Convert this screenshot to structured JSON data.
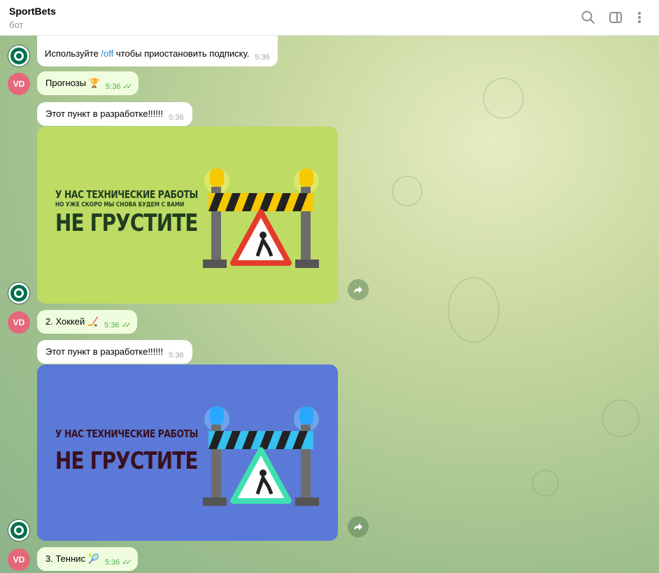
{
  "header": {
    "title": "SportBets",
    "subtitle": "бот"
  },
  "messages": {
    "m1": {
      "text_before": "Используйте ",
      "link": "/off",
      "text_after": " чтобы приостановить подписку.",
      "time": "5:36"
    },
    "m2": {
      "text": "Прогнозы 🏆",
      "time": "5:36"
    },
    "m3": {
      "text": "Этот пункт в разработке!!!!!!",
      "time": "5:36"
    },
    "m4": {
      "text": "2. Хоккей 🏒",
      "time": "5:36"
    },
    "m5": {
      "text": "Этот пункт в разработке!!!!!!",
      "time": "5:36"
    },
    "m6": {
      "text": "3. Теннис 🎾",
      "time": "5:36"
    }
  },
  "user_initials": "VD",
  "images": {
    "image1": {
      "line1": "У НАС ТЕХНИЧЕСКИЕ РАБОТЫ",
      "line2": "НО УЖЕ СКОРО МЫ СНОВА БУДЕМ С ВАМИ",
      "line3": "НЕ ГРУСТИТЕ",
      "background": "#bedb63",
      "text_color": "#1f3d22",
      "light_color": "#f5c800"
    },
    "image2": {
      "line1": "У НАС ТЕХНИЧЕСКИЕ РАБОТЫ",
      "line3": "НЕ ГРУСТИТЕ",
      "background": "#5b79d6",
      "text_color": "#3a1020",
      "light_color": "#2aa8ff"
    }
  },
  "colors": {
    "incoming_bubble": "#ffffff",
    "outgoing_bubble": "#effdde",
    "link": "#2a8bd0",
    "read_ticks": "#4fae4e",
    "user_avatar": "#e4687a"
  }
}
